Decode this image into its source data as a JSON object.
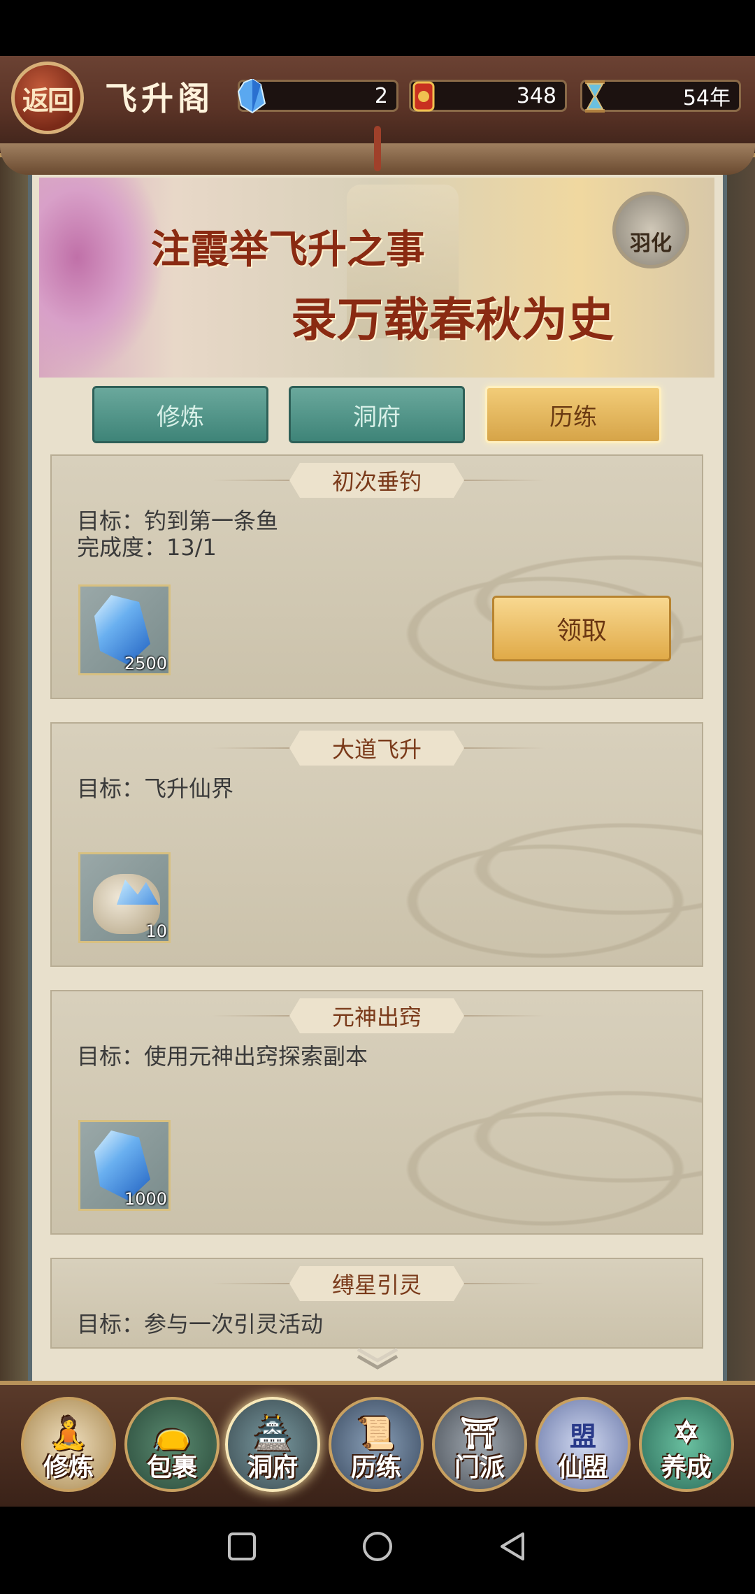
{
  "header": {
    "back_label": "返回",
    "title": "飞升阁",
    "resources": [
      {
        "icon": "crystal-icon",
        "value": "2"
      },
      {
        "icon": "token-icon",
        "value": "348"
      },
      {
        "icon": "hourglass-icon",
        "value": "54年"
      }
    ]
  },
  "banner": {
    "line1": "注霞举飞升之事",
    "line2": "录万载春秋为史",
    "badge_label": "羽化"
  },
  "tabs": [
    {
      "label": "修炼",
      "active": false
    },
    {
      "label": "洞府",
      "active": false
    },
    {
      "label": "历练",
      "active": true
    }
  ],
  "quests": [
    {
      "title": "初次垂钓",
      "goal": "目标：钓到第一条鱼",
      "progress": "完成度：13/1",
      "reward_icon": "crystal-icon",
      "reward_count": "2500",
      "claim_label": "领取"
    },
    {
      "title": "大道飞升",
      "goal": "目标：飞升仙界",
      "reward_icon": "crystal-bag-icon",
      "reward_count": "10"
    },
    {
      "title": "元神出窍",
      "goal": "目标：使用元神出窍探索副本",
      "reward_icon": "crystal-icon",
      "reward_count": "1000"
    },
    {
      "title": "缚星引灵",
      "goal": "目标：参与一次引灵活动"
    }
  ],
  "nav": [
    {
      "label": "修炼",
      "icon": "cultivator-icon"
    },
    {
      "label": "包裹",
      "icon": "bag-icon"
    },
    {
      "label": "洞府",
      "icon": "cave-house-icon"
    },
    {
      "label": "历练",
      "icon": "scroll-icon"
    },
    {
      "label": "门派",
      "icon": "sect-gate-icon"
    },
    {
      "label": "仙盟",
      "icon": "alliance-crown-icon",
      "emblem": "盟"
    },
    {
      "label": "养成",
      "icon": "pentagram-icon"
    }
  ],
  "accent_colors": {
    "gold": "#e0aa48",
    "teal": "#3e8478",
    "title_red": "#8a2a12"
  }
}
